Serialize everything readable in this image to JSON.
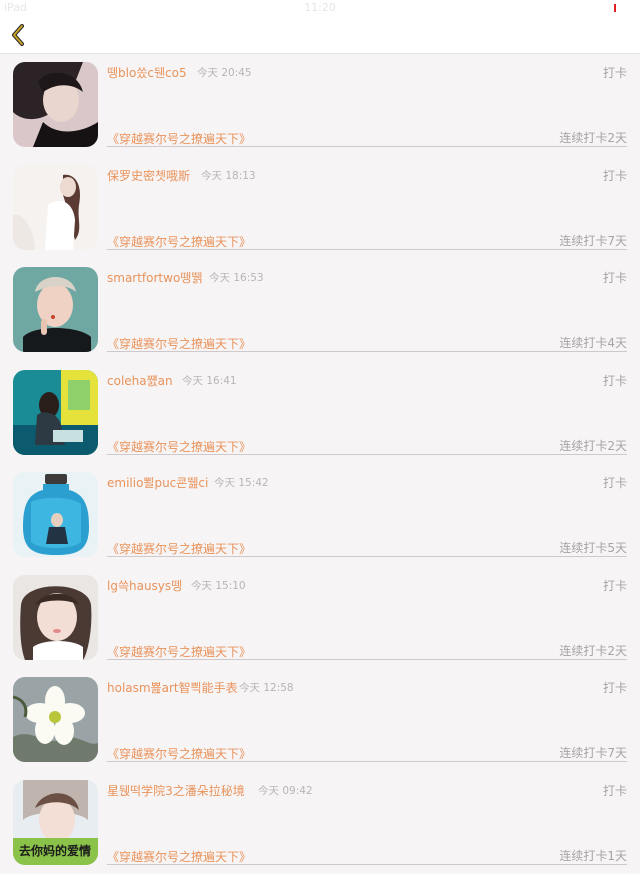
{
  "status_bar": {
    "carrier": "iPad",
    "time": "11:20"
  },
  "nav": {
    "back_icon": "chevron-left-icon",
    "accent": "#c9a227"
  },
  "colors": {
    "accent_text": "#e8935b",
    "muted_text": "#a8a3a6",
    "time_text": "#b9b4b6"
  },
  "feed": [
    {
      "username": "뗑blo쏬c뒌co5",
      "time": "今天 20:45",
      "action": "打卡",
      "book": "《穿越赛尔号之撩遍天下》",
      "streak": "连续打卡2天"
    },
    {
      "username": "保罗史密쳇哦斯",
      "time": "今天 18:13",
      "action": "打卡",
      "book": "《穿越赛尔号之撩遍天下》",
      "streak": "连续打卡7天"
    },
    {
      "username": "smartfortwo뗑뛝",
      "time": "今天 16:53",
      "action": "打卡",
      "book": "《穿越赛尔号之撩遍天下》",
      "streak": "连续打卡4天"
    },
    {
      "username": "coleha쨼an",
      "time": "今天 16:41",
      "action": "打卡",
      "book": "《穿越赛尔号之撩遍天下》",
      "streak": "连续打卡2天"
    },
    {
      "username": "emilio뾜puc쿈뛢ci",
      "time": "今天 15:42",
      "action": "打卡",
      "book": "《穿越赛尔号之撩遍天下》",
      "streak": "连续打卡5天"
    },
    {
      "username": "lg쓱hausys뗑",
      "time": "今天 15:10",
      "action": "打卡",
      "book": "《穿越赛尔号之撩遍天下》",
      "streak": "连续打卡2天"
    },
    {
      "username": "holasm뾾art智쁵能手表",
      "time": "今天 12:58",
      "action": "打卡",
      "book": "《穿越赛尔号之撩遍天下》",
      "streak": "连续打卡7天"
    },
    {
      "username": "星뒍떡学院3之潘朵拉秘境",
      "time": "今天 09:42",
      "action": "打卡",
      "book": "《穿越赛尔号之撩遍天下》",
      "streak": "连续打卡1天",
      "avatar_caption": "去你妈的爱情"
    }
  ]
}
